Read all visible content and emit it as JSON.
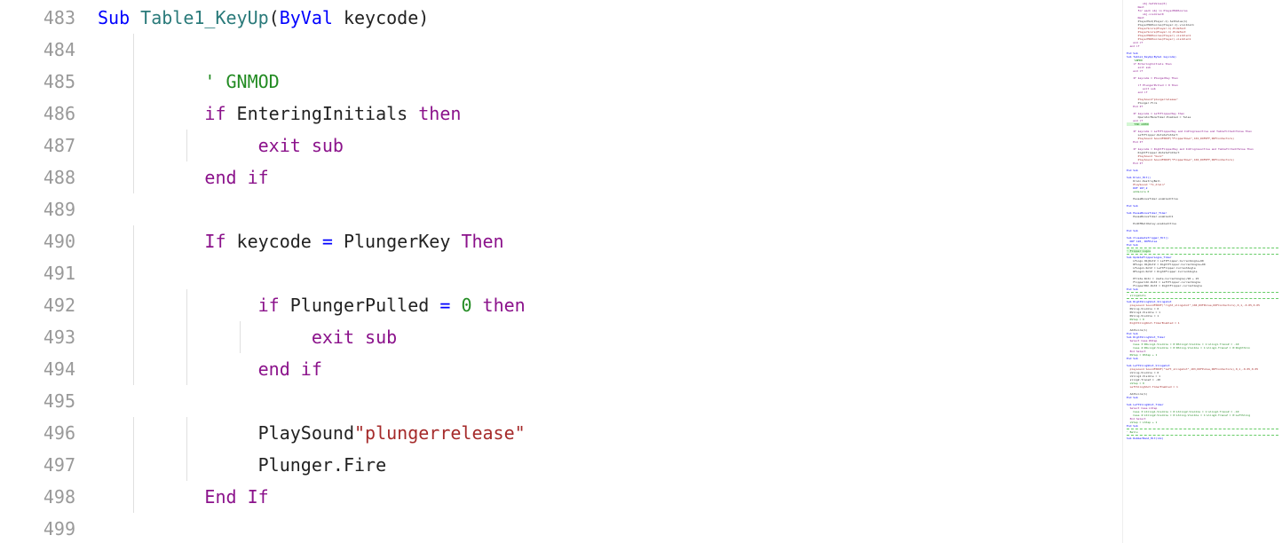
{
  "gutter": {
    "start": 483,
    "end": 499
  },
  "lines": [
    {
      "num": 483,
      "tokens": [
        [
          "kw-blue",
          "Sub"
        ],
        [
          "ident",
          " "
        ],
        [
          "fn-teal",
          "Table1_KeyUp"
        ],
        [
          "paren",
          "("
        ],
        [
          "kw-blue",
          "ByVal"
        ],
        [
          "ident",
          " keycode"
        ],
        [
          "paren",
          ")"
        ]
      ],
      "indent": 0
    },
    {
      "num": 484,
      "tokens": [],
      "indent": 1
    },
    {
      "num": 485,
      "tokens": [
        [
          "comment-green",
          "' GNMOD"
        ]
      ],
      "indent": 2
    },
    {
      "num": 486,
      "tokens": [
        [
          "kw-purple",
          "if"
        ],
        [
          "ident",
          " EnteringInitials "
        ],
        [
          "kw-purple",
          "then"
        ]
      ],
      "indent": 2
    },
    {
      "num": 487,
      "tokens": [
        [
          "kw-purple",
          "exit sub"
        ]
      ],
      "indent": 3
    },
    {
      "num": 488,
      "tokens": [
        [
          "kw-purple",
          "end if"
        ]
      ],
      "indent": 2
    },
    {
      "num": 489,
      "tokens": [],
      "indent": 0
    },
    {
      "num": 490,
      "tokens": [
        [
          "kw-purple",
          "If"
        ],
        [
          "ident",
          " keycode "
        ],
        [
          "kw-blue",
          "="
        ],
        [
          "ident",
          " PlungerKey "
        ],
        [
          "kw-purple",
          "Then"
        ]
      ],
      "indent": 2
    },
    {
      "num": 491,
      "tokens": [],
      "indent": 2
    },
    {
      "num": 492,
      "tokens": [
        [
          "kw-purple",
          "if"
        ],
        [
          "ident",
          " PlungerPulled "
        ],
        [
          "kw-blue",
          "="
        ],
        [
          "ident",
          " "
        ],
        [
          "num-green",
          "0"
        ],
        [
          "ident",
          " "
        ],
        [
          "kw-purple",
          "then"
        ]
      ],
      "indent": 3
    },
    {
      "num": 493,
      "tokens": [
        [
          "kw-purple",
          "exit sub"
        ]
      ],
      "indent": 4
    },
    {
      "num": 494,
      "tokens": [
        [
          "kw-purple",
          "end if"
        ]
      ],
      "indent": 3
    },
    {
      "num": 495,
      "tokens": [],
      "indent": 0
    },
    {
      "num": 496,
      "tokens": [
        [
          "ident",
          "PlaySound"
        ],
        [
          "str-red",
          "\"plungerrelease\""
        ]
      ],
      "indent": 3
    },
    {
      "num": 497,
      "tokens": [
        [
          "ident",
          "Plunger.Fire"
        ]
      ],
      "indent": 3
    },
    {
      "num": 498,
      "tokens": [
        [
          "kw-purple",
          "End If"
        ]
      ],
      "indent": 2
    },
    {
      "num": 499,
      "tokens": [],
      "indent": 0
    }
  ],
  "minimap": [
    {
      "c": "mm-purple",
      "t": "          obj.SetValue(0)"
    },
    {
      "c": "mm-purple",
      "t": "       Next"
    },
    {
      "c": "mm-purple",
      "t": "       For each obj in PlayerHUDScores"
    },
    {
      "c": "mm-purple",
      "t": "          obj.visible=0"
    },
    {
      "c": "mm-purple",
      "t": "       Next"
    },
    {
      "c": "mm-dark",
      "t": "       PlayerHud(Player-1).SetValue(1)"
    },
    {
      "c": "mm-dark",
      "t": "       PlayerHUDScores(Player-1).visible=1"
    },
    {
      "c": "mm-red",
      "t": "       PlayerScore(Player-1).HideText"
    },
    {
      "c": "mm-red",
      "t": "       PlayerScore(Player-1).HideText"
    },
    {
      "c": "mm-red",
      "t": "       PlayerHUDScores(Player).visible=1"
    },
    {
      "c": "mm-red",
      "t": "       PlayerHUDScores(Player).visible=1"
    },
    {
      "c": "mm-purple",
      "t": "    end if"
    },
    {
      "c": "mm-purple",
      "t": "  end if"
    },
    {
      "c": "mm-dark",
      "t": ""
    },
    {
      "c": "mm-blue",
      "t": "End Sub"
    },
    {
      "c": "mm-blue",
      "t": "Sub Table1_KeyUp(ByVal keycode)"
    },
    {
      "c": "mm-green",
      "t": "    'GNMOD"
    },
    {
      "c": "mm-purple",
      "t": "    if EnteringInitials then"
    },
    {
      "c": "mm-purple",
      "t": "       exit sub"
    },
    {
      "c": "mm-purple",
      "t": "    end if"
    },
    {
      "c": "mm-dark",
      "t": ""
    },
    {
      "c": "mm-purple",
      "t": "    If keycode = PlungerKey Then"
    },
    {
      "c": "mm-dark",
      "t": ""
    },
    {
      "c": "mm-purple",
      "t": "       if PlungerPulled = 0 then"
    },
    {
      "c": "mm-purple",
      "t": "          exit sub"
    },
    {
      "c": "mm-purple",
      "t": "       end if"
    },
    {
      "c": "mm-dark",
      "t": ""
    },
    {
      "c": "mm-red",
      "t": "       PlaySound\"plungerrelease\""
    },
    {
      "c": "mm-dark",
      "t": "       Plunger.Fire"
    },
    {
      "c": "mm-purple",
      "t": "    End If"
    },
    {
      "c": "mm-dark",
      "t": ""
    },
    {
      "c": "mm-purple",
      "t": "    If keycode = LeftFlipperKey then"
    },
    {
      "c": "mm-dark",
      "t": "       OperatorMenuTimer.Enabled = false"
    },
    {
      "c": "mm-purple",
      "t": "    end if"
    },
    {
      "c": "mm-green",
      "t": "    'END GNMOD",
      "hl": true
    },
    {
      "c": "mm-dark",
      "t": ""
    },
    {
      "c": "mm-purple",
      "t": "    If keycode = LeftFlipperKey and InProgress=true and TableTilted=false Then"
    },
    {
      "c": "mm-dark",
      "t": "       LeftFlipper.RotateToStart"
    },
    {
      "c": "mm-red",
      "t": "       PlaySound SoundFXDOF(\"FlipperDown\",101,DOFOFF,DOFContactors)"
    },
    {
      "c": "mm-purple",
      "t": "    End If"
    },
    {
      "c": "mm-dark",
      "t": ""
    },
    {
      "c": "mm-purple",
      "t": "    If keycode = RightFlipperKey and InProgress=true and TableTilted=false Then"
    },
    {
      "c": "mm-dark",
      "t": "       RightFlipper.RotateToStart"
    },
    {
      "c": "mm-red",
      "t": "       PlaySound \"buzz\""
    },
    {
      "c": "mm-red",
      "t": "       PlaySound SoundFXDOF(\"FlipperDown\",102,DOFOFF,DOFContactors)"
    },
    {
      "c": "mm-purple",
      "t": "    End If"
    },
    {
      "c": "mm-dark",
      "t": ""
    },
    {
      "c": "mm-blue",
      "t": "End Sub"
    },
    {
      "c": "mm-dark",
      "t": ""
    },
    {
      "c": "mm-blue",
      "t": "Sub Drain_Hit()"
    },
    {
      "c": "mm-dark",
      "t": "    Drain.DestroyBall"
    },
    {
      "c": "mm-red",
      "t": "    PlaySound \"fx_drain\""
    },
    {
      "c": "mm-blue",
      "t": "    DOF 107,2"
    },
    {
      "c": "mm-green",
      "t": "    addscore 0"
    },
    {
      "c": "mm-dark",
      "t": ""
    },
    {
      "c": "mm-dark",
      "t": "    PauseBonusTimer.enabled=true"
    },
    {
      "c": "mm-dark",
      "t": ""
    },
    {
      "c": "mm-blue",
      "t": "End Sub"
    },
    {
      "c": "mm-dark",
      "t": ""
    },
    {
      "c": "mm-blue",
      "t": "Sub PauseBonusTimer_Timer"
    },
    {
      "c": "mm-dark",
      "t": "    PauseBonusTimer.enabled=1"
    },
    {
      "c": "mm-dark",
      "t": ""
    },
    {
      "c": "mm-dark",
      "t": "    EndOfBallDelay.enabled=true"
    },
    {
      "c": "mm-dark",
      "t": ""
    },
    {
      "c": "mm-blue",
      "t": "End Sub"
    },
    {
      "c": "mm-dark",
      "t": ""
    },
    {
      "c": "mm-blue",
      "t": "Sub CloseGateTrigger_Hit()"
    },
    {
      "c": "mm-blue",
      "t": "  DOF 126, DOFPulse"
    },
    {
      "c": "mm-blue",
      "t": "End Sub"
    },
    {
      "c": "mm-gray",
      "t": "'**********************************************",
      "sep": true
    },
    {
      "c": "mm-green",
      "t": "' Flipper Logos",
      "hl": true
    },
    {
      "c": "mm-gray",
      "t": "'**********************************************",
      "sep": true
    },
    {
      "c": "mm-blue",
      "t": "Sub UpdateFlipperLogos_Timer"
    },
    {
      "c": "mm-dark",
      "t": "    LFLogo.ObjRotZ = LeftFlipper.CurrentAngle+90"
    },
    {
      "c": "mm-dark",
      "t": "    RFLogo.ObjRotZ = RightFlipper.CurrentAngle+90"
    },
    {
      "c": "mm-dark",
      "t": "    LFLogo1.RotZ = LeftFlipper.CurrentAngle"
    },
    {
      "c": "mm-dark",
      "t": "    RFLogo1.RotZ = RightFlipper.CurrentAngle"
    },
    {
      "c": "mm-dark",
      "t": ""
    },
    {
      "c": "mm-dark",
      "t": "    Pfrate.Rotz = (Gate.CurrentAngle)/90 + 25"
    },
    {
      "c": "mm-dark",
      "t": "    FlipperLSh.RotZ = LeftFlipper.currentAngle"
    },
    {
      "c": "mm-dark",
      "t": "    FlipperRSh.RotZ = RightFlipper.currentAngle"
    },
    {
      "c": "mm-blue",
      "t": "End Sub"
    },
    {
      "c": "mm-gray",
      "t": "'********************",
      "sep": true
    },
    {
      "c": "mm-green",
      "t": "' slingshots"
    },
    {
      "c": "mm-gray",
      "t": "'********************",
      "sep": true
    },
    {
      "c": "mm-blue",
      "t": "Sub RightSlingShot_Slingshot"
    },
    {
      "c": "mm-red",
      "t": "  playsound SoundFXDOF(\"right_slingshot\",104,DOFPulse,DOFContactors),0,1,-0.05,0.05"
    },
    {
      "c": "mm-dark",
      "t": "  RSling.Visible = 0"
    },
    {
      "c": "mm-dark",
      "t": "  RSling1.Visible = 1"
    },
    {
      "c": "mm-dark",
      "t": "  RSling.Visible = 1"
    },
    {
      "c": "mm-green",
      "t": "  RStep = 0"
    },
    {
      "c": "mm-red",
      "t": "  RightSlingShot.TimerEnabled = 1"
    },
    {
      "c": "mm-dark",
      "t": ""
    },
    {
      "c": "mm-dark",
      "t": "  AddScore(1)"
    },
    {
      "c": "mm-blue",
      "t": "End Sub"
    },
    {
      "c": "mm-blue",
      "t": "Sub RightSlingShot_Timer"
    },
    {
      "c": "mm-purple",
      "t": "  Select Case RStep"
    },
    {
      "c": "mm-green",
      "t": "    Case 3:RSLing1.Visible = 0:RSling2.Visible = 1:sling1.TransZ = -10"
    },
    {
      "c": "mm-green",
      "t": "    Case 4:RSLing2.Visible = 0:RSling.Visible = 1:sling1.TransZ = 0:RightSlin"
    },
    {
      "c": "mm-purple",
      "t": "  End Select"
    },
    {
      "c": "mm-green",
      "t": "  RStep = RStep + 1"
    },
    {
      "c": "mm-blue",
      "t": "End Sub"
    },
    {
      "c": "mm-dark",
      "t": ""
    },
    {
      "c": "mm-blue",
      "t": "Sub LeftSlingShot_Slingshot"
    },
    {
      "c": "mm-red",
      "t": "  playsound SoundFXDOF(\"left_slingshot\",103,DOFPulse,DOFContactors),0,1,-0.05,0.05"
    },
    {
      "c": "mm-dark",
      "t": "  LSling.Visible = 0"
    },
    {
      "c": "mm-dark",
      "t": "  LSling1.Visible = 1"
    },
    {
      "c": "mm-dark",
      "t": "  sling2.TransZ = -20"
    },
    {
      "c": "mm-green",
      "t": "  LStep = 0"
    },
    {
      "c": "mm-red",
      "t": "  LeftSlingShot.TimerEnabled = 1"
    },
    {
      "c": "mm-dark",
      "t": ""
    },
    {
      "c": "mm-dark",
      "t": "  AddScore(1)"
    },
    {
      "c": "mm-blue",
      "t": "End Sub"
    },
    {
      "c": "mm-dark",
      "t": ""
    },
    {
      "c": "mm-blue",
      "t": "Sub LeftSlingShot_Timer"
    },
    {
      "c": "mm-purple",
      "t": "  Select Case LStep"
    },
    {
      "c": "mm-green",
      "t": "    Case 3:LSling1.Visible = 0:LSling2.Visible = 1:sling2.TransZ = -10"
    },
    {
      "c": "mm-green",
      "t": "    Case 4:LSling2.Visible = 0:LSling.Visible = 1:sling2.TransZ = 0:LeftSling"
    },
    {
      "c": "mm-purple",
      "t": "  End Select"
    },
    {
      "c": "mm-green",
      "t": "  LStep = LStep + 1"
    },
    {
      "c": "mm-blue",
      "t": "End Sub"
    },
    {
      "c": "mm-gray",
      "t": "'**********",
      "sep": true
    },
    {
      "c": "mm-green",
      "t": "' Balls"
    },
    {
      "c": "mm-gray",
      "t": "'**********",
      "sep": true
    },
    {
      "c": "mm-blue",
      "t": "Sub RubberBand_Hit(idx)"
    }
  ]
}
